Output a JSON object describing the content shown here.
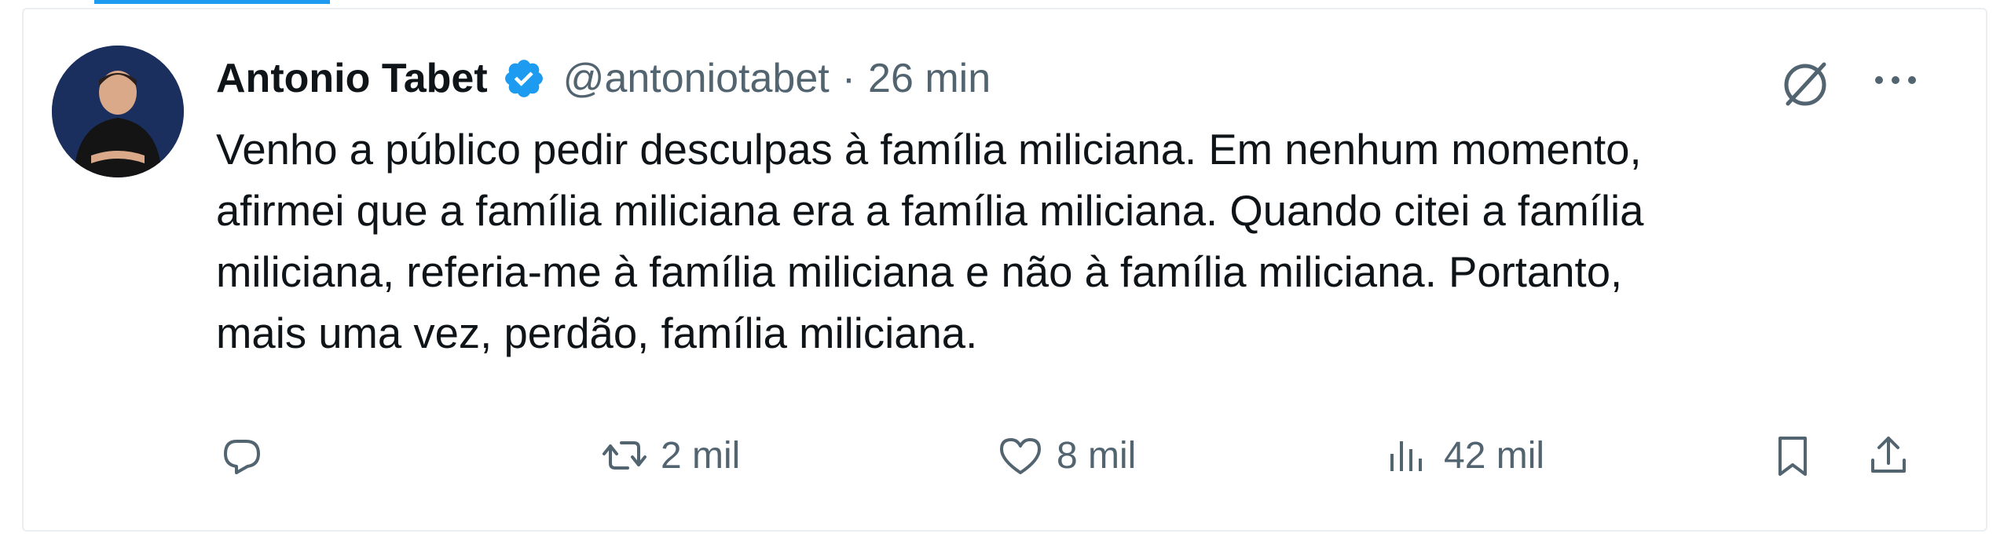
{
  "post": {
    "author": {
      "name": "Antonio Tabet",
      "handle": "@antoniotabet",
      "separator": "·",
      "time": "26 min",
      "verified": true
    },
    "text_lines": [
      "Venho a público pedir desculpas à família miliciana. Em nenhum momento,",
      "afirmei que a família miliciana era a família miliciana. Quando citei a família",
      "miliciana, referia-me à família miliciana e não à família miliciana. Portanto,",
      "mais uma vez, perdão, família miliciana."
    ],
    "actions": {
      "reply": {
        "icon": "reply-icon"
      },
      "retweet": {
        "icon": "retweet-icon",
        "count": "2 mil"
      },
      "like": {
        "icon": "heart-icon",
        "count": "8 mil"
      },
      "views": {
        "icon": "views-icon",
        "count": "42 mil"
      },
      "bookmark": {
        "icon": "bookmark-icon"
      },
      "share": {
        "icon": "share-icon"
      }
    },
    "header_icons": [
      "grok-icon",
      "more-icon"
    ]
  },
  "colors": {
    "text": "#0f1419",
    "secondary": "#536471",
    "accent": "#1d9bf0",
    "border": "#eceff1"
  }
}
